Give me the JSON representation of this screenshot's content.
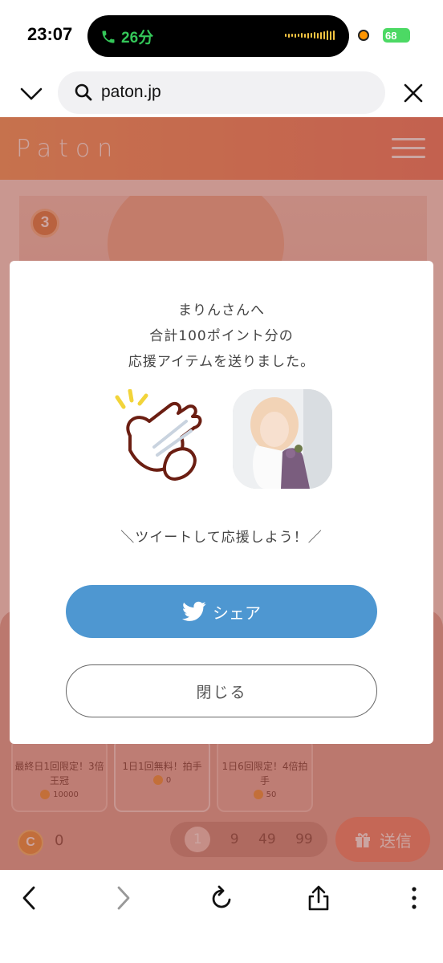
{
  "status": {
    "time": "23:07",
    "call": "26分",
    "battery": "68"
  },
  "browser": {
    "url": "paton.jp"
  },
  "header": {
    "logo": "Paton"
  },
  "photo": {
    "rank": "3"
  },
  "modal": {
    "line1": "まりんさんへ",
    "line2": "合計100ポイント分の",
    "line3": "応援アイテムを送りました。",
    "tweet_prompt": "＼ツイートして応援しよう！／",
    "share_label": "シェア",
    "close_label": "閉じる"
  },
  "items": [
    {
      "name": "最終日1回限定！3倍王冠",
      "price": "10000"
    },
    {
      "name": "1日1回無料！拍手",
      "price": "0"
    },
    {
      "name": "1日6回限定！4倍拍手",
      "price": "50"
    }
  ],
  "controls": {
    "points": "0",
    "coin_symbol": "C",
    "qty_options": [
      "1",
      "9",
      "49",
      "99"
    ],
    "send_label": "送信"
  },
  "colors": {
    "header_start": "#f7a76f",
    "header_end": "#f28a73",
    "share_blue": "#4e97d1",
    "coin": "#f0a050"
  }
}
